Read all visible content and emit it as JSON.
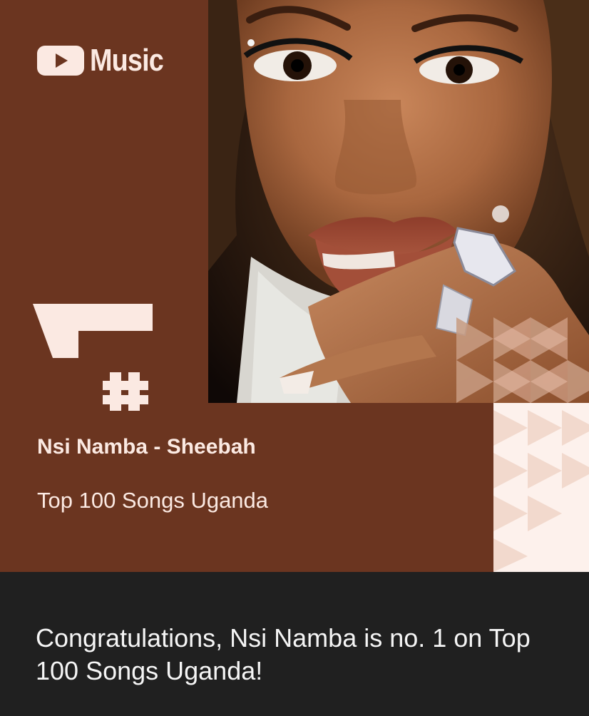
{
  "card": {
    "brand": "Music",
    "rank": "1",
    "rank_symbol": "#",
    "song_title": "Nsi Namba - Sheebah",
    "chart_name": "Top 100 Songs Uganda"
  },
  "message": "Congratulations, Nsi Namba is no. 1 on Top 100 Songs Uganda!",
  "colors": {
    "card_bg": "#6b3520",
    "accent_light": "#fbe9e2",
    "page_bg": "#202020"
  },
  "icons": [
    "youtube-play-icon"
  ]
}
